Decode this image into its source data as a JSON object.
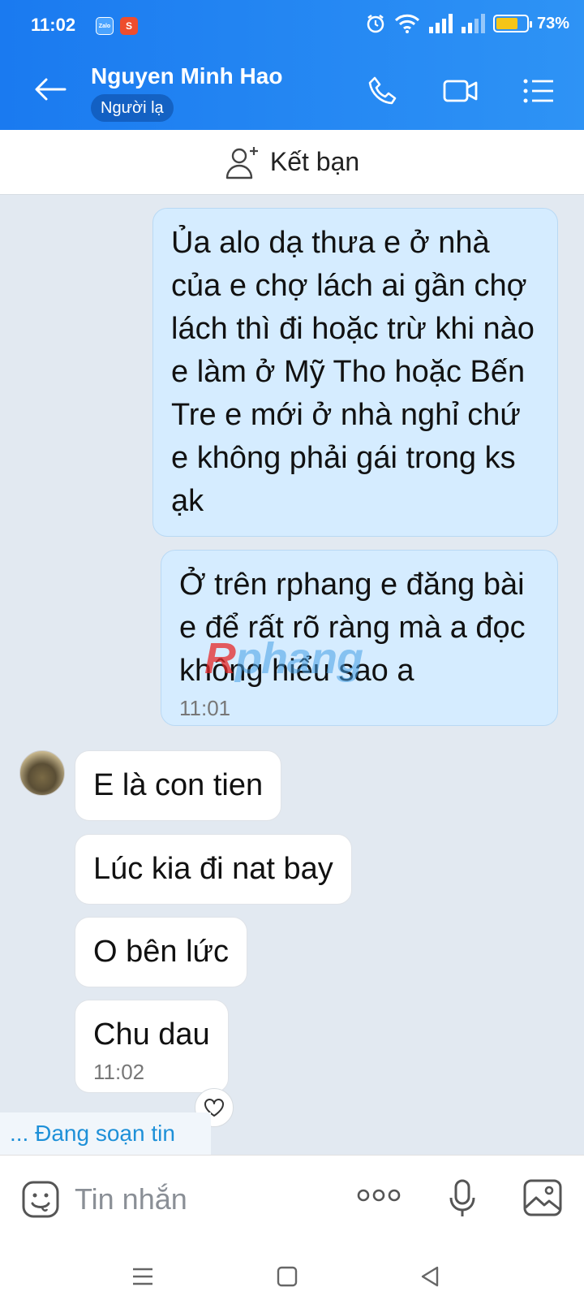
{
  "status_bar": {
    "time": "11:02",
    "app_icon_1": "Zalo",
    "app_icon_2": "S",
    "battery": "73%",
    "battery_level": 0.73
  },
  "header": {
    "contact_name": "Nguyen Minh Hao",
    "tag": "Người lạ"
  },
  "friend_bar": {
    "label": "Kết bạn"
  },
  "messages": {
    "sent_1": "Ủa alo dạ thưa e ở nhà của e chợ lách ai gần chợ lách thì đi hoặc trừ khi nào e làm ở Mỹ Tho hoặc Bến Tre e mới ở nhà nghỉ chứ e không phải gái trong ks ạk",
    "sent_2": "Ở trên rphang e đăng bài e để rất rõ ràng mà a đọc không hiểu sao a",
    "sent_2_time": "11:01",
    "recv_1": "E là con tien",
    "recv_2": "Lúc kia đi nat bay",
    "recv_3": "O bên lức",
    "recv_4": "Chu dau",
    "recv_4_time": "11:02"
  },
  "watermark": {
    "first": "R",
    "rest": "phang"
  },
  "typing_indicator": "... Đang soạn tin",
  "input": {
    "placeholder": "Tin nhắn"
  },
  "colors": {
    "header_blue": "#1a7af0",
    "sent_bubble": "#d5ecff",
    "chat_bg": "#e2e9f1",
    "typing_text": "#1e90d8"
  }
}
